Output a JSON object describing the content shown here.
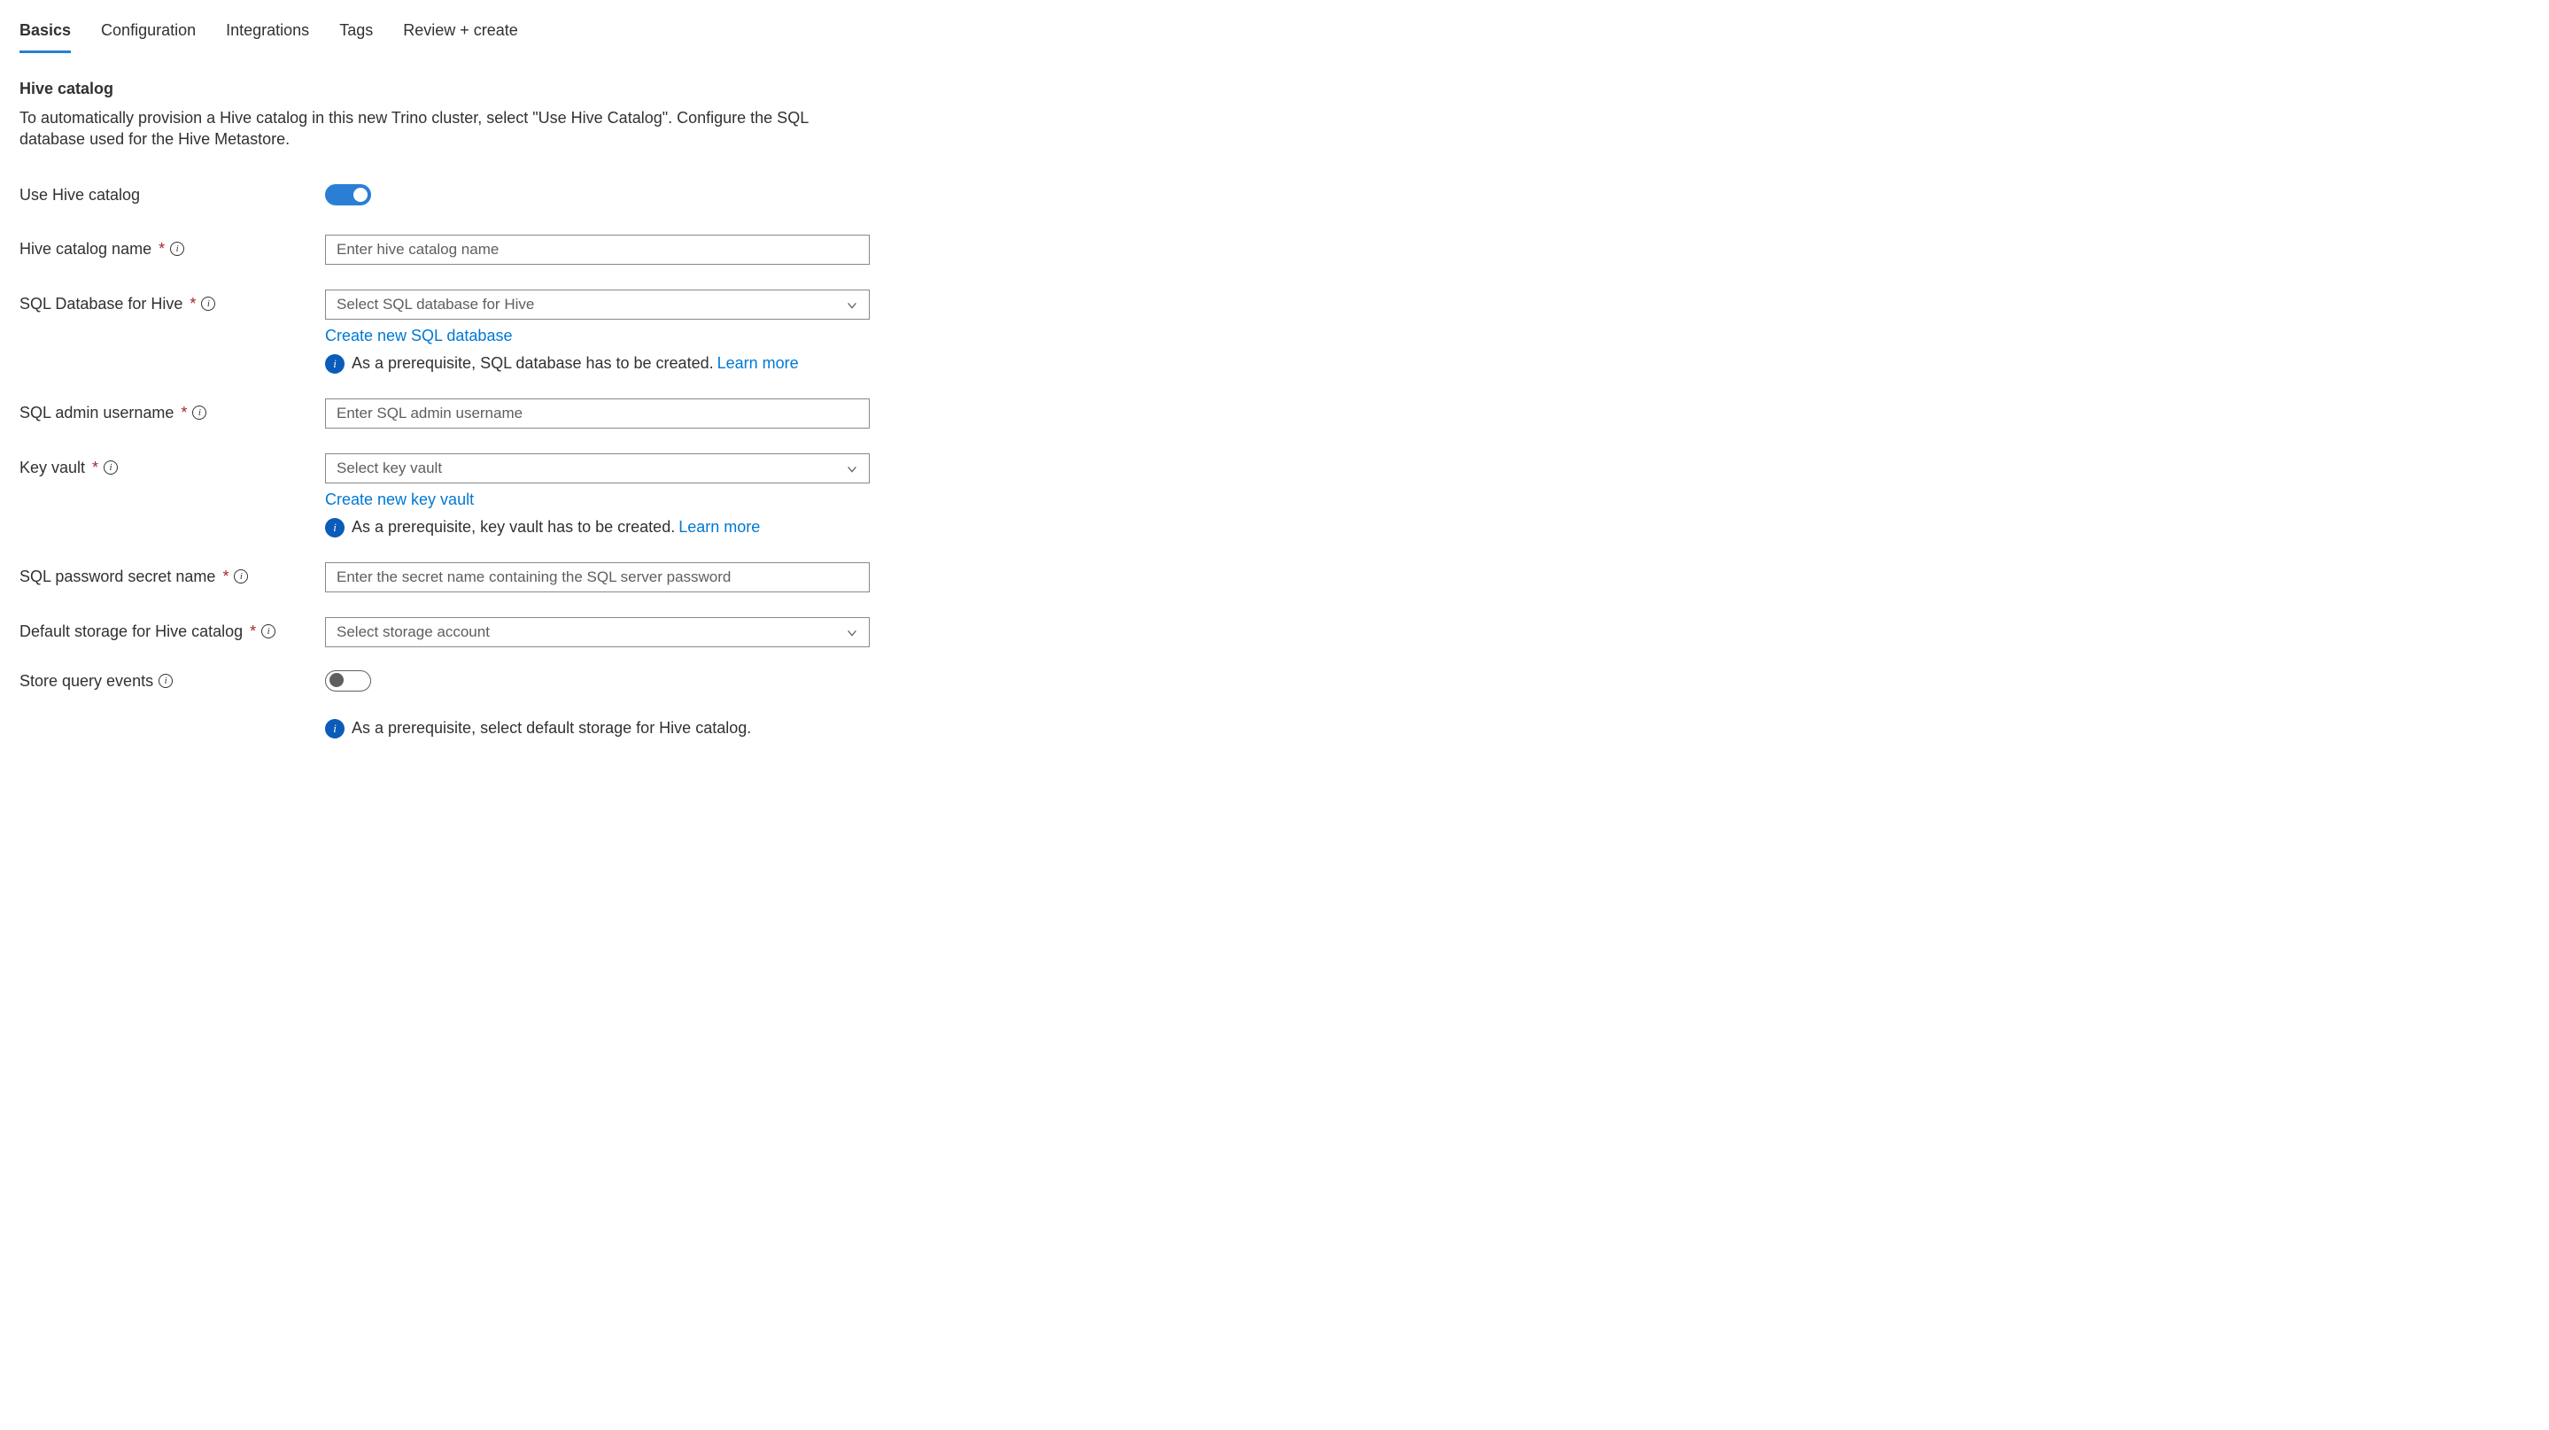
{
  "tabs": {
    "basics": "Basics",
    "configuration": "Configuration",
    "integrations": "Integrations",
    "tags": "Tags",
    "review": "Review + create"
  },
  "section": {
    "title": "Hive catalog",
    "description": "To automatically provision a Hive catalog in this new Trino cluster, select \"Use Hive Catalog\". Configure the SQL database used for the Hive Metastore."
  },
  "fields": {
    "useHive": {
      "label": "Use Hive catalog"
    },
    "catalogName": {
      "label": "Hive catalog name",
      "placeholder": "Enter hive catalog name"
    },
    "sqlDb": {
      "label": "SQL Database for Hive",
      "placeholder": "Select SQL database for Hive",
      "createLink": "Create new SQL database",
      "prereq": "As a prerequisite, SQL database has to be created.",
      "learnMore": "Learn more"
    },
    "sqlUser": {
      "label": "SQL admin username",
      "placeholder": "Enter SQL admin username"
    },
    "keyVault": {
      "label": "Key vault",
      "placeholder": "Select key vault",
      "createLink": "Create new key vault",
      "prereq": "As a prerequisite, key vault has to be created.",
      "learnMore": "Learn more"
    },
    "secretName": {
      "label": "SQL password secret name",
      "placeholder": "Enter the secret name containing the SQL server password"
    },
    "storage": {
      "label": "Default storage for Hive catalog",
      "placeholder": "Select storage account"
    },
    "storeEvents": {
      "label": "Store query events",
      "prereq": "As a prerequisite, select default storage for Hive catalog."
    }
  }
}
